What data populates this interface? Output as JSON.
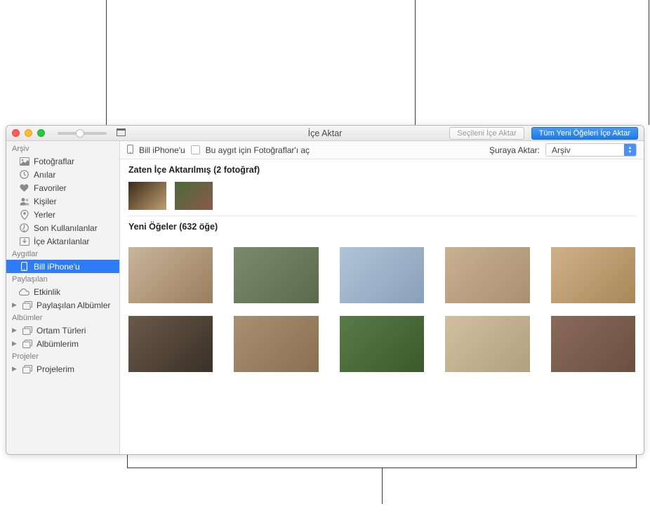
{
  "titlebar": {
    "title": "İçe Aktar",
    "import_selected": "Seçileni İçe Aktar",
    "import_all_new": "Tüm Yeni Öğeleri İçe Aktar"
  },
  "toolbar": {
    "device_name": "Bill iPhone'u",
    "open_photos_for_device": "Bu aygıt için Fotoğraflar'ı aç",
    "import_to_label": "Şuraya Aktar:",
    "import_to_value": "Arşiv"
  },
  "sidebar": {
    "library_header": "Arşiv",
    "devices_header": "Aygıtlar",
    "shared_header": "Paylaşılan",
    "albums_header": "Albümler",
    "projects_header": "Projeler",
    "items": {
      "photos": "Fotoğraflar",
      "memories": "Anılar",
      "favorites": "Favoriler",
      "people": "Kişiler",
      "places": "Yerler",
      "recents": "Son Kullanılanlar",
      "imports": "İçe Aktarılanlar",
      "device": "Bill iPhone'u",
      "activity": "Etkinlik",
      "shared_albums": "Paylaşılan Albümler",
      "media_types": "Ortam Türleri",
      "my_albums": "Albümlerim",
      "my_projects": "Projelerim"
    }
  },
  "sections": {
    "already_imported": "Zaten İçe Aktarılmış (2 fotoğraf)",
    "new_items": "Yeni Öğeler (632 öğe)"
  }
}
